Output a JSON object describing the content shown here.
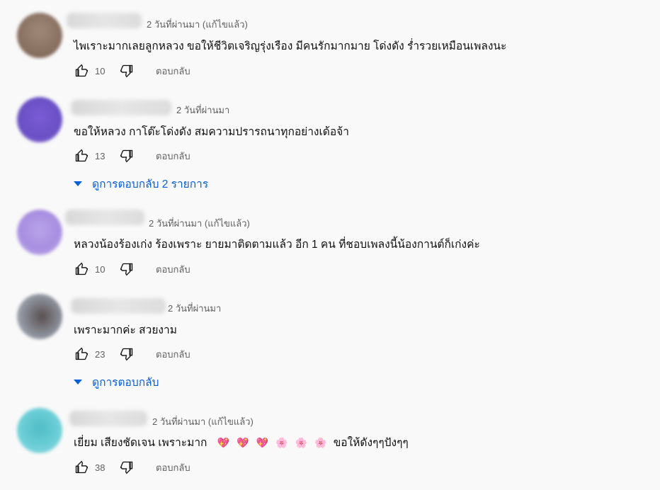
{
  "comments": [
    {
      "meta": "2 วันที่ผ่านมา (แก้ไขแล้ว)",
      "text": "ไพเราะมากเลยลูกหลวง ขอให้ชีวิตเจริญรุ่งเรือง มีคนรักมากมาย โด่งดัง ร่ำรวยเหมือนเพลงนะ",
      "likes": "10",
      "reply_label": "ตอบกลับ",
      "avatar_color": "#8a6f5e"
    },
    {
      "meta": "2 วันที่ผ่านมา",
      "text": "ขอให้หลวง กาโต๊ะโด่งดัง สมความปรารถนาทุกอย่างเด้อจ้า",
      "likes": "13",
      "reply_label": "ตอบกลับ",
      "replies_label": "ดูการตอบกลับ 2 รายการ",
      "avatar_color": "#6a4fc4"
    },
    {
      "meta": "2 วันที่ผ่านมา (แก้ไขแล้ว)",
      "text": "หลวงน้องร้องเก่ง ร้องเพราะ ยายมาติดตามแล้ว อีก 1 คน ที่ชอบเพลงนี้น้องกานต์ก็เก่งค่ะ",
      "likes": "10",
      "reply_label": "ตอบกลับ",
      "avatar_color": "#a88ee0"
    },
    {
      "meta": "2 วันที่ผ่านมา",
      "text": "เพราะมากค่ะ สวยงาม",
      "likes": "23",
      "reply_label": "ตอบกลับ",
      "replies_label": "ดูการตอบกลับ",
      "avatar_color": "#6f6f78"
    },
    {
      "meta": "2 วันที่ผ่านมา (แก้ไขแล้ว)",
      "text_prefix": "เยี่ยม เสียงชัดเจน เพราะมาก",
      "emojis": [
        "💖",
        "💖",
        "💖",
        "🌸",
        "🌸",
        "🌸"
      ],
      "text_suffix": "ขอให้ดังๆๆปังๆๆ",
      "likes": "38",
      "reply_label": "ตอบกลับ",
      "avatar_color": "#5fc6cf"
    }
  ]
}
